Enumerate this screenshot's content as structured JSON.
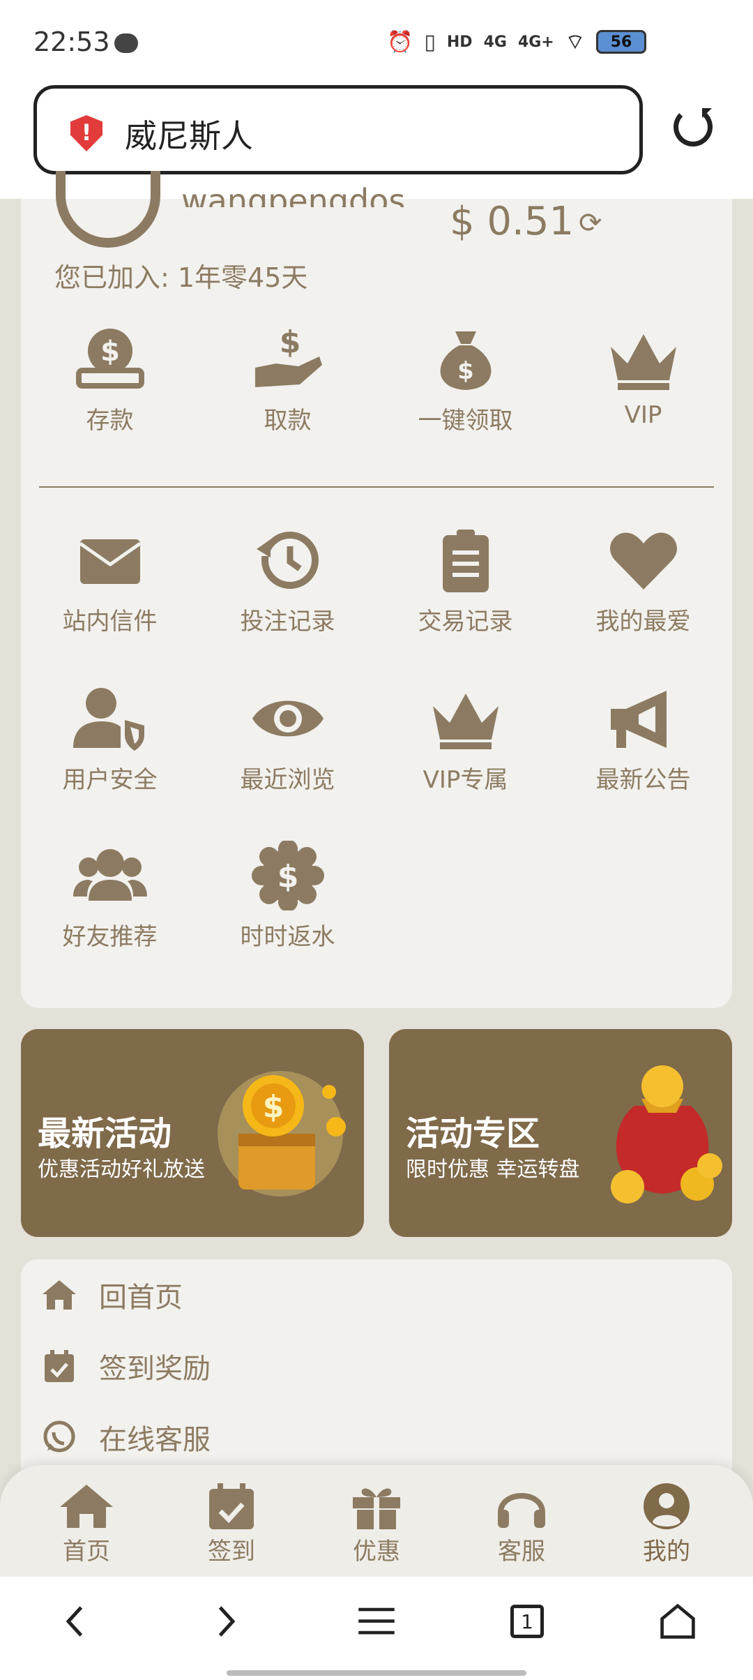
{
  "status_bar": {
    "time": "22:53",
    "hd": "HD",
    "net1": "4G",
    "net2": "4G+",
    "battery": "56"
  },
  "address_bar": {
    "site_name": "威尼斯人"
  },
  "account": {
    "username": "wangpengdos",
    "balance": "$ 0.51",
    "joined": "您已加入: 1年零45天"
  },
  "quick_actions": [
    {
      "label": "存款",
      "icon": "dollar-coin-icon"
    },
    {
      "label": "取款",
      "icon": "hand-dollar-icon"
    },
    {
      "label": "一键领取",
      "icon": "money-bag-icon"
    },
    {
      "label": "VIP",
      "icon": "crown-icon"
    }
  ],
  "features_row1": [
    {
      "label": "站内信件",
      "icon": "envelope-icon"
    },
    {
      "label": "投注记录",
      "icon": "history-icon"
    },
    {
      "label": "交易记录",
      "icon": "clipboard-list-icon"
    },
    {
      "label": "我的最爱",
      "icon": "heart-icon"
    }
  ],
  "features_row2": [
    {
      "label": "用户安全",
      "icon": "user-shield-icon"
    },
    {
      "label": "最近浏览",
      "icon": "eye-icon"
    },
    {
      "label": "VIP专属",
      "icon": "crown-icon"
    },
    {
      "label": "最新公告",
      "icon": "megaphone-icon"
    }
  ],
  "features_row3": [
    {
      "label": "好友推荐",
      "icon": "users-icon"
    },
    {
      "label": "时时返水",
      "icon": "dollar-badge-icon"
    }
  ],
  "promos": [
    {
      "title": "最新活动",
      "subtitle": "优惠活动好礼放送"
    },
    {
      "title": "活动专区",
      "subtitle": "限时优惠 幸运转盘"
    }
  ],
  "menu": [
    {
      "label": "回首页",
      "icon": "home-icon"
    },
    {
      "label": "签到奖励",
      "icon": "calendar-check-icon"
    },
    {
      "label": "在线客服",
      "icon": "whatsapp-icon"
    }
  ],
  "tabs": [
    {
      "label": "首页",
      "icon": "home-icon"
    },
    {
      "label": "签到",
      "icon": "calendar-check-icon"
    },
    {
      "label": "优惠",
      "icon": "gift-icon"
    },
    {
      "label": "客服",
      "icon": "headset-icon"
    },
    {
      "label": "我的",
      "icon": "user-circle-icon",
      "active": true
    }
  ],
  "browser_nav": {
    "tab_count": "1"
  },
  "colors": {
    "brand": "#7f6a4a",
    "icon": "#8c7b62",
    "card": "#f2f1ee",
    "page": "#e4e1d9"
  }
}
